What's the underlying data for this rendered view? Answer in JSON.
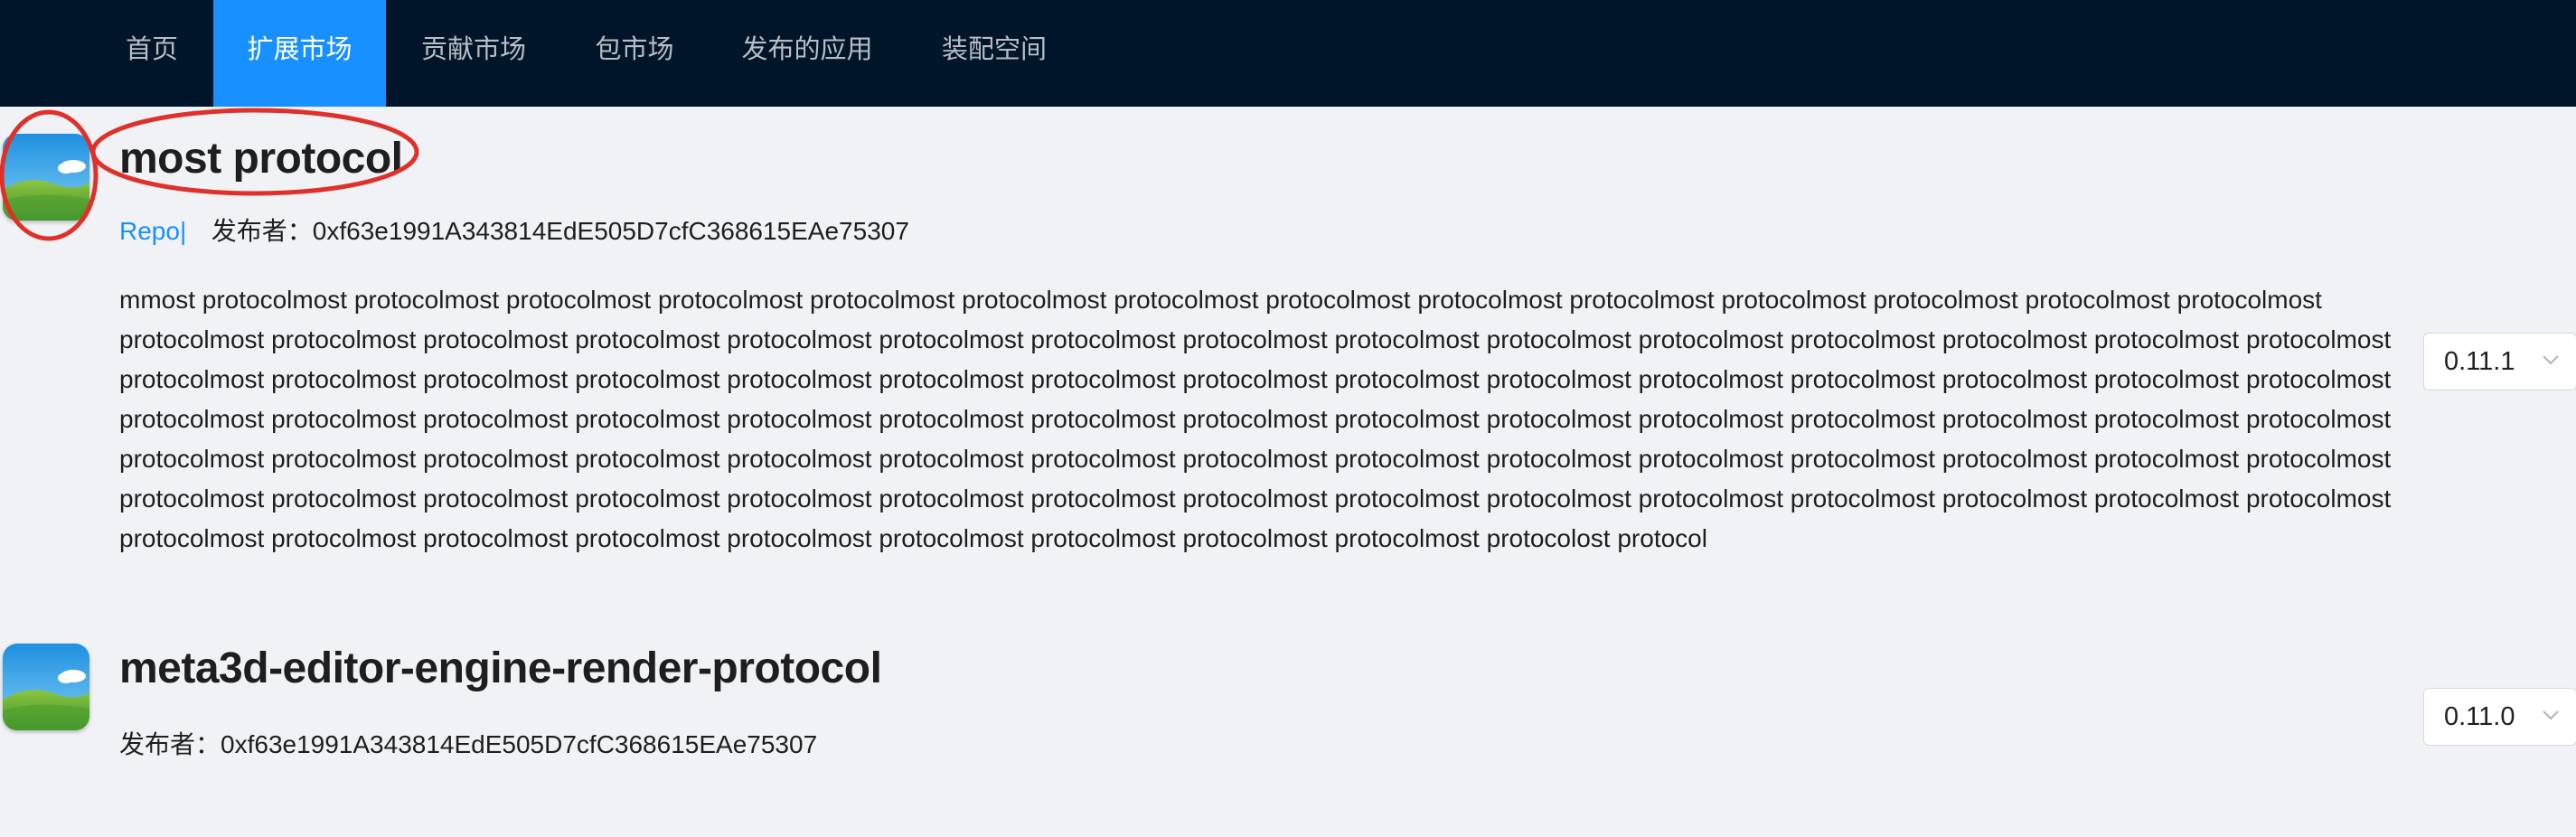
{
  "nav": {
    "items": [
      {
        "label": "首页"
      },
      {
        "label": "扩展市场",
        "active": true
      },
      {
        "label": "贡献市场"
      },
      {
        "label": "包市场"
      },
      {
        "label": "发布的应用"
      },
      {
        "label": "装配空间"
      }
    ]
  },
  "protocols": [
    {
      "name": "most protocol",
      "repo_label": "Repo|",
      "publisher_prefix": "发布者：",
      "publisher": "0xf63e1991A343814EdE505D7cfC368615EAe75307",
      "description": "mmost protocolmost protocolmost protocolmost protocolmost protocolmost protocolmost protocolmost protocolmost protocolmost protocolmost protocolmost protocolmost protocolmost protocolmost protocolmost protocolmost protocolmost protocolmost protocolmost protocolmost protocolmost protocolmost protocolmost protocolmost protocolmost protocolmost protocolmost protocolmost protocolmost protocolmost protocolmost protocolmost protocolmost protocolmost protocolmost protocolmost protocolmost protocolmost protocolmost protocolmost protocolmost protocolmost protocolmost protocolmost protocolmost protocolmost protocolmost protocolmost protocolmost protocolmost protocolmost protocolmost protocolmost protocolmost protocolmost protocolmost protocolmost protocolmost protocolmost protocolmost protocolmost protocolmost protocolmost protocolmost protocolmost protocolmost protocolmost protocolmost protocolmost protocolmost protocolmost protocolmost protocolmost protocolmost protocolmost protocolmost protocolmost protocolmost protocolmost protocolmost protocolmost protocolmost protocolmost protocolmost protocolmost protocolmost protocolmost protocolmost protocolmost protocolmost protocolmost protocolmost protocolmost protocolmost protocolmost protocolmost protocolmost protocolmost protocolost protocol",
      "version": "0.11.1"
    },
    {
      "name": "meta3d-editor-engine-render-protocol",
      "publisher_prefix": "发布者：",
      "publisher": "0xf63e1991A343814EdE505D7cfC368615EAe75307",
      "version": "0.11.0"
    }
  ],
  "annotation_color": "#e0302a",
  "colors": {
    "nav_bg": "#001529",
    "nav_active": "#1890ff",
    "page_bg": "#f0f2f5",
    "link": "#1890ff"
  }
}
